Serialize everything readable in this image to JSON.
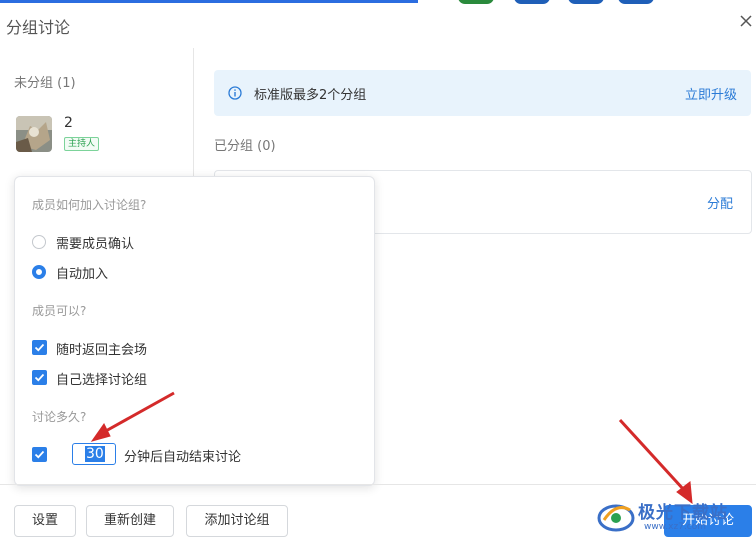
{
  "dialog": {
    "title": "分组讨论",
    "close_icon": "close-icon"
  },
  "left": {
    "ungrouped_label": "未分组 (1)",
    "member": {
      "name": "2",
      "badge": "主持人"
    }
  },
  "notice": {
    "icon": "info-icon",
    "text": "标准版最多2个分组",
    "link": "立即升级"
  },
  "grouped": {
    "label": "已分组 (0)",
    "assign_link": "分配"
  },
  "settings_popup": {
    "join_question": "成员如何加入讨论组?",
    "join_options": [
      {
        "label": "需要成员确认",
        "checked": false
      },
      {
        "label": "自动加入",
        "checked": true
      }
    ],
    "can_question": "成员可以?",
    "can_options": [
      {
        "label": "随时返回主会场",
        "checked": true
      },
      {
        "label": "自己选择讨论组",
        "checked": true
      }
    ],
    "duration_question": "讨论多久?",
    "duration": {
      "checked": true,
      "minutes": "30",
      "suffix": "分钟后自动结束讨论"
    }
  },
  "footer": {
    "settings": "设置",
    "recreate": "重新创建",
    "add_group": "添加讨论组",
    "start": "开始讨论"
  },
  "watermark": {
    "text": "极光下载站",
    "sub": "www.xz7.com"
  },
  "colors": {
    "accent": "#2b7fe8",
    "notice_bg": "#e8f3fc",
    "badge_green": "#2aa150",
    "arrow_red": "#d42a2a"
  }
}
